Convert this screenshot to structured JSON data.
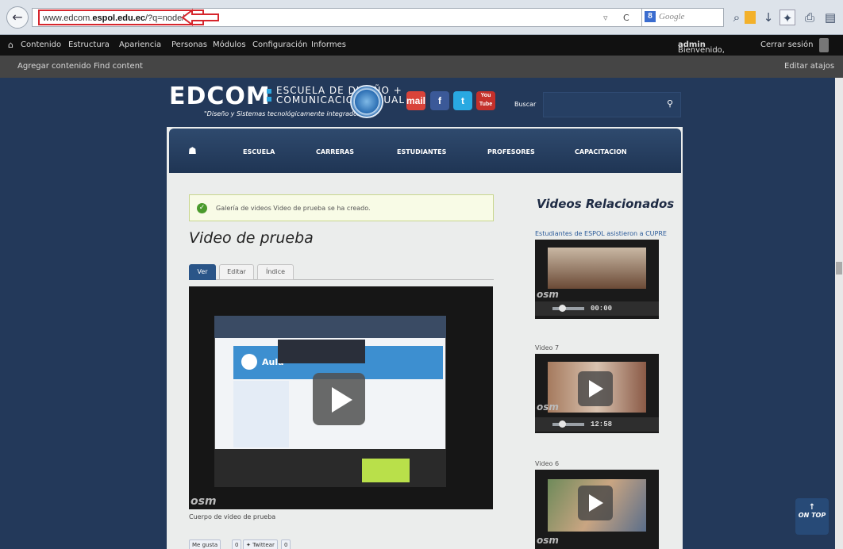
{
  "browser": {
    "url_prefix": "www.edcom.",
    "url_domain": "espol.edu.ec",
    "url_path": "/?q=node/166",
    "search_placeholder": "Google",
    "google_badge": "8",
    "dropdown_glyph": "▿",
    "reload_glyph": "C"
  },
  "admin_menu": {
    "home_icon": "home-icon",
    "items": [
      "Contenido",
      "Estructura",
      "Apariencia",
      "Personas",
      "Módulos",
      "Configuración",
      "Informes"
    ],
    "welcome": "Bienvenido,",
    "username": "admin",
    "logout": "Cerrar sesión"
  },
  "shortcuts": {
    "items": [
      "Agregar contenido",
      "Find content"
    ],
    "edit": "Editar atajos"
  },
  "header": {
    "logo": "EDCOM",
    "logo_line1": "ESCUELA DE DISEÑO +",
    "logo_line2": "COMUNICACIÓN VISUAL",
    "tagline": "\"Diseño y Sistemas tecnológicamente integrados\"",
    "social": [
      "mail",
      "f",
      "t",
      "You Tube"
    ],
    "search_label": "Buscar",
    "search_icon": "magnifier-icon"
  },
  "nav": {
    "items": [
      "ESCUELA",
      "CARRERAS",
      "ESTUDIANTES",
      "PROFESORES",
      "CAPACITACION"
    ]
  },
  "message": "Galería de videos Video de prueba se ha creado.",
  "page_title": "Video de prueba",
  "tabs": [
    "Ver",
    "Editar",
    "Índice"
  ],
  "player": {
    "watermark": "osm",
    "screen_brand": "Aula"
  },
  "caption": "Cuerpo de video de prueba",
  "share": {
    "like": "Me gusta",
    "like_count": "0",
    "tweet": "Twittear",
    "tweet_count": "0"
  },
  "sidebar": {
    "title": "Videos Relacionados",
    "videos": [
      {
        "title": "Estudiantes de ESPOL asistieron a CUPRE",
        "time": "00:00"
      },
      {
        "title": "Video 7",
        "time": "12:58"
      },
      {
        "title": "Video 6",
        "time": ""
      }
    ],
    "watermark": "osm"
  },
  "ontop": {
    "arrow": "↑",
    "label": "ON TOP"
  },
  "colors": {
    "accent": "#2a5588",
    "url_highlight": "#d6262d",
    "admin_bar": "#111111"
  }
}
